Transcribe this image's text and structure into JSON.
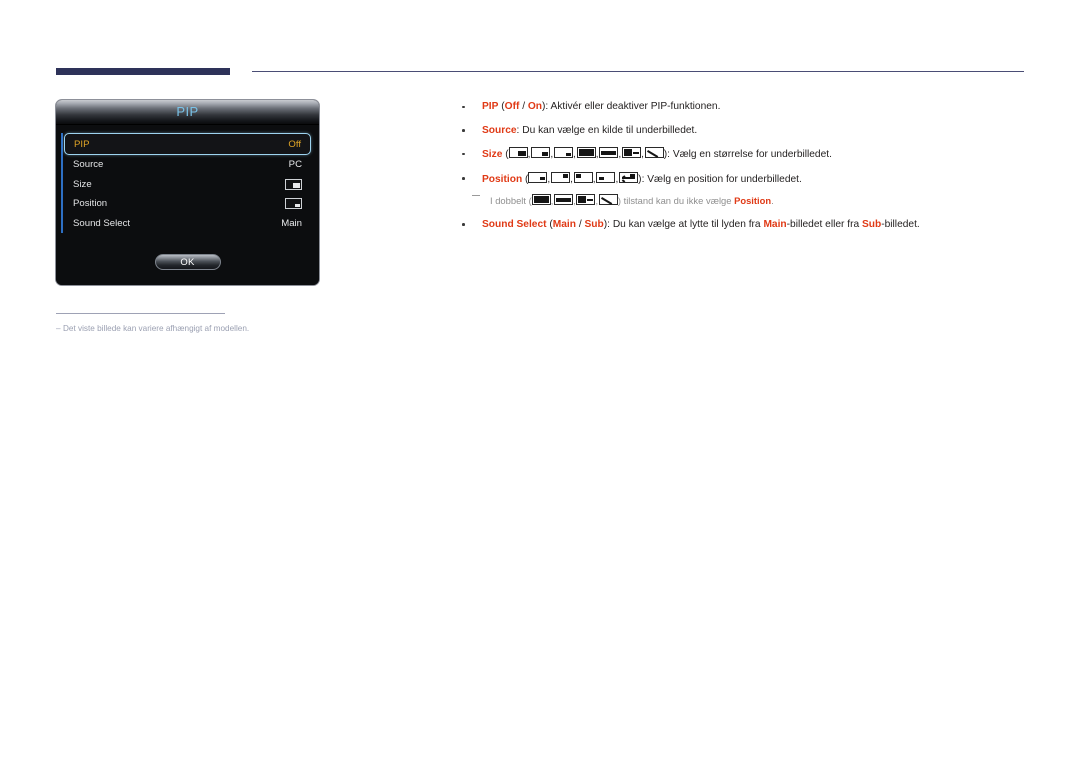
{
  "page": {
    "title": "PIP",
    "language": "da"
  },
  "osd": {
    "title": "PIP",
    "rows": [
      {
        "label": "PIP",
        "value": "Off",
        "value_type": "text",
        "selected": true
      },
      {
        "label": "Source",
        "value": "PC",
        "value_type": "text",
        "selected": false
      },
      {
        "label": "Size",
        "value": "",
        "value_type": "icon",
        "icon": "screen-size-icon",
        "selected": false
      },
      {
        "label": "Position",
        "value": "",
        "value_type": "icon",
        "icon": "screen-position-icon",
        "selected": false
      },
      {
        "label": "Sound Select",
        "value": "Main",
        "value_type": "text",
        "selected": false
      }
    ],
    "ok_label": "OK",
    "colors": {
      "selected_text": "#e0a526",
      "title_text": "#79c2e8",
      "accent_line": "#2d6fc4",
      "body_bg": "#0c0d0f"
    }
  },
  "footnote": {
    "dash": "–",
    "text": "Det viste billede kan variere afhængigt af modellen."
  },
  "bullets": [
    {
      "id": "pip",
      "keyword": "PIP",
      "open_paren": " (",
      "opt_a": "Off",
      "slash": " / ",
      "opt_b": "On",
      "close_paren": "): ",
      "body": "Aktivér eller deaktiver PIP-funktionen."
    },
    {
      "id": "source",
      "keyword": "Source",
      "colon": ": ",
      "body": "Du kan vælge en kilde til underbilledet."
    },
    {
      "id": "size",
      "keyword": "Size",
      "open_paren": " (",
      "close_paren": "): ",
      "body": "Vælg en størrelse for underbilledet.",
      "icons": [
        "pip-size-large-icon",
        "pip-size-medium-icon",
        "pip-size-small-icon",
        "pip-double-wide-icon",
        "pip-double-equal-icon",
        "pip-double-line-icon",
        "pip-double-diagonal-icon"
      ]
    },
    {
      "id": "position",
      "keyword": "Position",
      "open_paren": " (",
      "close_paren": "): ",
      "body": "Vælg en position for underbilledet.",
      "icons": [
        "pip-position-bottom-right-icon",
        "pip-position-top-right-icon",
        "pip-position-top-left-icon",
        "pip-position-bottom-left-icon",
        "pip-position-custom-icon"
      ]
    }
  ],
  "subnote": {
    "text_before": "I dobbelt (",
    "text_middle": ") tilstand kan du ikke vælge ",
    "keyword": "Position",
    "text_after": ".",
    "icons": [
      "pip-double-wide-icon",
      "pip-double-equal-icon",
      "pip-double-line-icon",
      "pip-double-diagonal-icon"
    ]
  },
  "bullet_sound": {
    "id": "sound-select",
    "keyword": "Sound Select",
    "open_paren": " (",
    "opt_a": "Main",
    "slash": " / ",
    "opt_b": "Sub",
    "close_paren": "): ",
    "body_1": "Du kan vælge at lytte til lyden fra ",
    "kw_main": "Main",
    "body_2": "-billedet eller fra ",
    "kw_sub": "Sub",
    "body_3": "-billedet."
  }
}
